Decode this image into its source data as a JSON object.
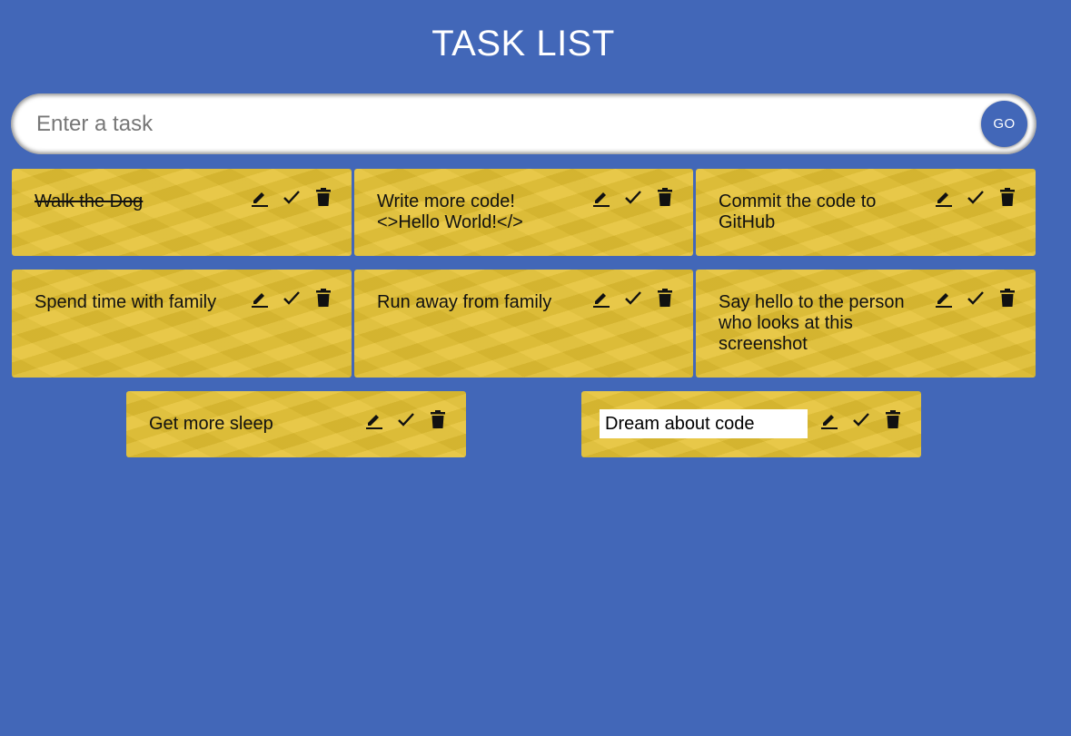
{
  "header": {
    "title": "TASK LIST"
  },
  "search": {
    "placeholder": "Enter a task",
    "value": "",
    "go_label": "GO"
  },
  "colors": {
    "background": "#4267b8",
    "card": "#e5c233",
    "text": "#111111"
  },
  "tasks": [
    {
      "text": "Walk the Dog",
      "done": true
    },
    {
      "text": "Write more code! <>Hello World!</>",
      "done": false
    },
    {
      "text": "Commit the code to GitHub",
      "done": false
    },
    {
      "text": "Spend time with family",
      "done": false
    },
    {
      "text": "Run away from family",
      "done": false
    },
    {
      "text": "Say hello to the person who looks at this screenshot",
      "done": false
    },
    {
      "text": "Get more sleep",
      "done": false
    },
    {
      "text": "Dream about code",
      "done": false,
      "editing": true
    }
  ],
  "icons": {
    "edit": "edit-icon",
    "complete": "check-icon",
    "delete": "trash-icon"
  }
}
